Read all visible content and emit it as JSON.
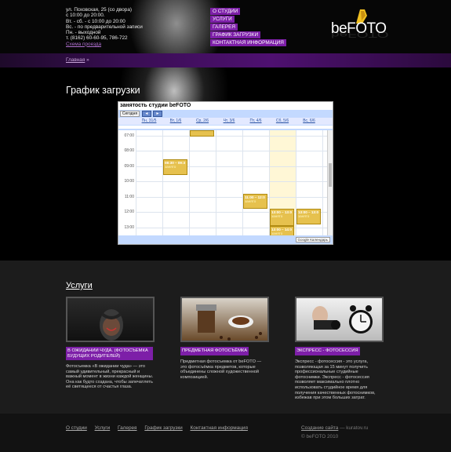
{
  "header": {
    "address_lines": [
      "ул. Псковская, 25 (со двора)",
      "с 10:00 до 20:00.",
      "Вт. - сб. - с 10:00 до 20:00",
      "Вс. - по предварительной записи",
      "Пн. - выходной",
      "т. (8162) 60-60-95, 786-722"
    ],
    "map_link": "Схема проезда",
    "nav": [
      "О СТУДИИ",
      "УСЛУГИ",
      "ГАЛЕРЕЯ",
      "ГРАФИК ЗАГРУЗКИ",
      "КОНТАКТНАЯ ИНФОРМАЦИЯ"
    ],
    "logo": {
      "prefix": "be",
      "suffix": "FOTO"
    }
  },
  "breadcrumb": {
    "home": "Главная",
    "sep": "»"
  },
  "page_title": "График загрузки",
  "calendar": {
    "title": "занятость студии beFOTO",
    "today_button": "Сегодня",
    "prev": "◄",
    "next": "►",
    "days": [
      "Пн, 31/5",
      "Вт, 1/6",
      "Ср, 2/6",
      "Чт, 3/6",
      "Пт, 4/6",
      "Сб, 5/6",
      "Вс, 6/6"
    ],
    "today_index": 5,
    "times": [
      "07:00",
      "08:00",
      "09:00",
      "10:00",
      "11:00",
      "12:00",
      "13:00"
    ],
    "start_hour": 6.65,
    "events": [
      {
        "day": 2,
        "start": 6.65,
        "end": 7.05,
        "time": "",
        "label": ""
      },
      {
        "day": 1,
        "start": 8.55,
        "end": 9.55,
        "time": "08:30 – 09:3",
        "label": "занято"
      },
      {
        "day": 4,
        "start": 10.8,
        "end": 11.8,
        "time": "11:00 – 12:0",
        "label": "занято"
      },
      {
        "day": 5,
        "start": 11.8,
        "end": 12.9,
        "time": "13:00 – 13:0",
        "label": "занято"
      },
      {
        "day": 6,
        "start": 11.8,
        "end": 12.8,
        "time": "13:00 – 13:0",
        "label": "занято"
      },
      {
        "day": 5,
        "start": 12.9,
        "end": 13.7,
        "time": "13:00 – 14:0",
        "label": "занято"
      }
    ],
    "badge": "Google Календарь"
  },
  "services": {
    "title": "Услуги",
    "items": [
      {
        "label": "В ОЖИДАНИИ ЧУДА.  (ФОТОСЪЕМКА БУДУЩИХ РОДИТЕЛЕЙ)",
        "desc": "Фотосъемка «В ожидании чуда» — это самый удивительный, прекрасный и важный момент в жизни каждой женщины. Она как будто создана, чтобы запечатлеть её светящееся от счастья глаза."
      },
      {
        "label": "ПРЕДМЕТНАЯ ФОТОСЪЁМКА",
        "desc": "Предметная фотосъемка от beFOTO — это фотосъёмка предметов, которые объединены сложной художественной композицией."
      },
      {
        "label": "ЭКСПРЕСС - ФОТОСЕССИЯ",
        "desc": "Экспресс - фотосессия - это услуга, позволяющая за 15 минут получить профессиональные студийные фотоснимки. Экспресс - фотосессия позволяет максимально плотно использовать студийное время для получения качественных фотоснимков, избежав при этом больших затрат."
      }
    ]
  },
  "footer": {
    "nav": [
      "О студии",
      "Услуги",
      "Галерея",
      "График загрузки",
      "Контактная информация"
    ],
    "credit_link": "Создание сайта",
    "credit_rest": " — kuratov.ru",
    "copyright": "© beFOTO 2010"
  },
  "colors": {
    "accent": "#7d1fa8",
    "event": "#e6c14e",
    "today": "#fff7d6"
  }
}
